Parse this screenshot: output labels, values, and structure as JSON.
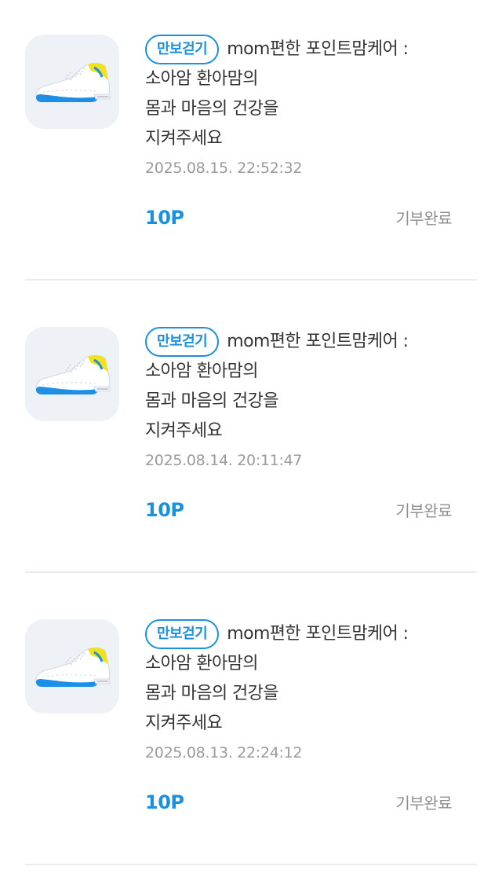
{
  "items": [
    {
      "badge": "만보걷기",
      "title_line1": "mom편한 포인트맘케어 :",
      "title_line2": "소아암 환아맘의",
      "title_line3": "몸과 마음의 건강을",
      "title_line4": "지켜주세요",
      "date": "2025.08.15. 22:52:32",
      "points": "10P",
      "status": "기부완료",
      "icon": "sneaker-icon"
    },
    {
      "badge": "만보걷기",
      "title_line1": "mom편한 포인트맘케어 :",
      "title_line2": "소아암 환아맘의",
      "title_line3": "몸과 마음의 건강을",
      "title_line4": "지켜주세요",
      "date": "2025.08.14. 20:11:47",
      "points": "10P",
      "status": "기부완료",
      "icon": "sneaker-icon"
    },
    {
      "badge": "만보걷기",
      "title_line1": "mom편한 포인트맘케어 :",
      "title_line2": "소아암 환아맘의",
      "title_line3": "몸과 마음의 건강을",
      "title_line4": "지켜주세요",
      "date": "2025.08.13. 22:24:12",
      "points": "10P",
      "status": "기부완료",
      "icon": "sneaker-icon"
    }
  ],
  "colors": {
    "accent": "#1a90e0",
    "icon_bg": "#eef1f5",
    "shoe_blue": "#1e8fe6",
    "shoe_yellow": "#f2e21a",
    "muted_text": "#9b9b9b",
    "divider": "#ececec"
  }
}
